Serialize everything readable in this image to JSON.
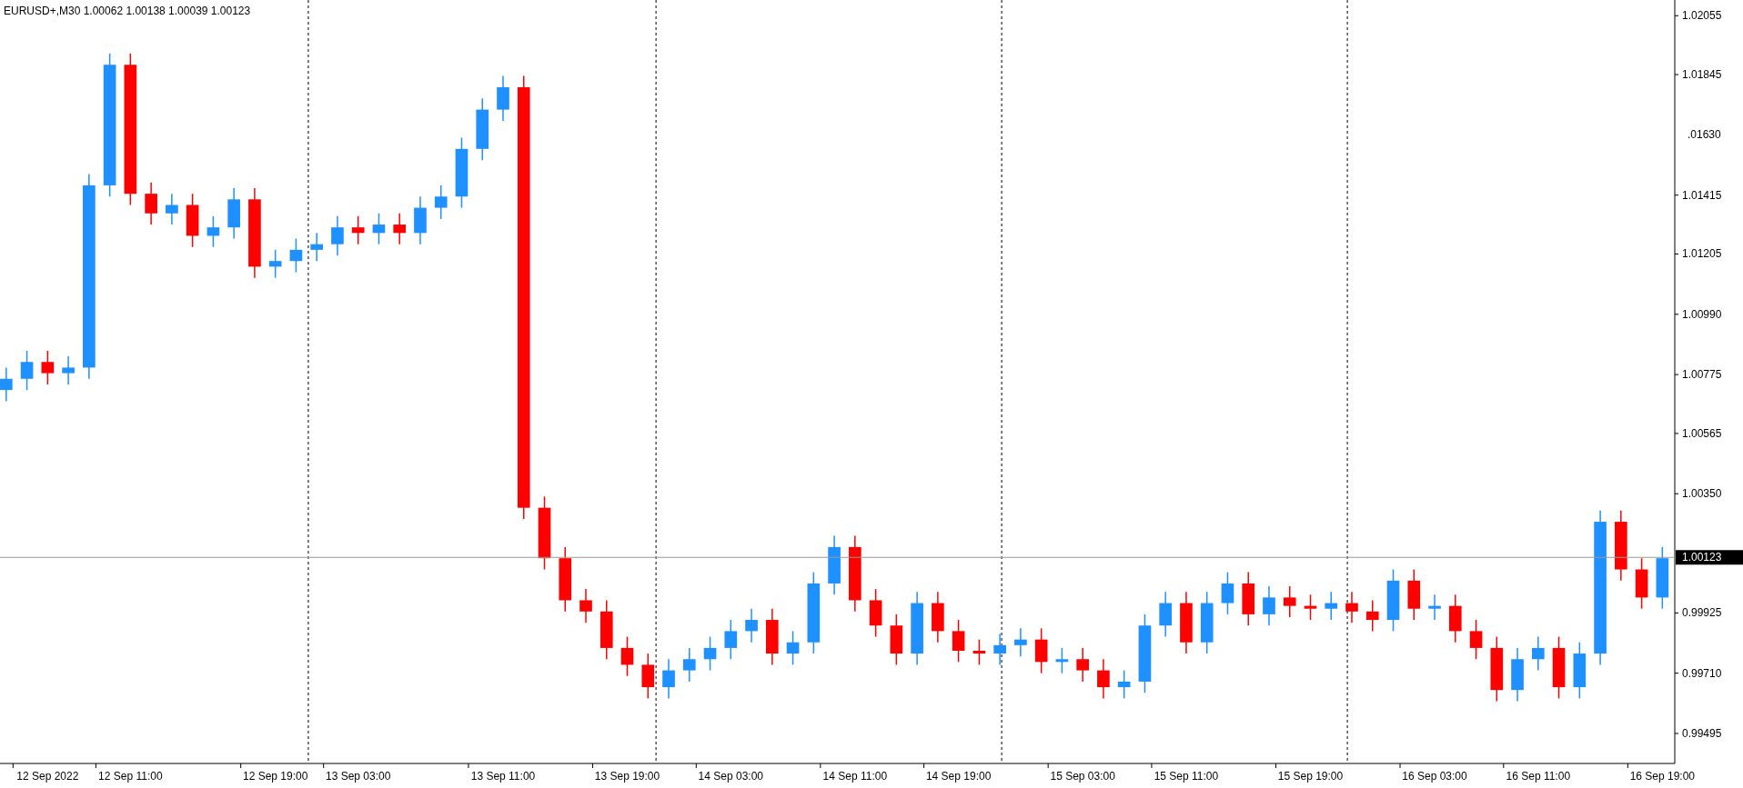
{
  "chart": {
    "title": "EURUSD+,M30  1.00062 1.00138 1.00039 1.00123",
    "clipped_price_label": ".01630",
    "chart_data": {
      "type": "candlestick",
      "ylim": [
        0.99388,
        1.02111
      ],
      "categories": [
        null,
        null,
        "12 Sep 2022",
        null,
        null,
        null,
        "12 Sep 11:00",
        null,
        null,
        null,
        null,
        null,
        null,
        "12 Sep 19:00",
        null,
        null,
        null,
        "13 Sep 03:00",
        null,
        null,
        null,
        null,
        null,
        null,
        "13 Sep 11:00",
        null,
        null,
        null,
        null,
        null,
        "13 Sep 19:00",
        null,
        null,
        null,
        null,
        "14 Sep 03:00",
        null,
        null,
        null,
        null,
        null,
        "14 Sep 11:00",
        null,
        null,
        null,
        null,
        "14 Sep 19:00",
        null,
        null,
        null,
        null,
        null,
        "15 Sep 03:00",
        null,
        null,
        null,
        null,
        "15 Sep 11:00",
        null,
        null,
        null,
        null,
        null,
        "15 Sep 19:00",
        null,
        null,
        null,
        null,
        null,
        "16 Sep 03:00",
        null,
        null,
        null,
        null,
        "16 Sep 11:00",
        null,
        null,
        null,
        null,
        null,
        "16 Sep 19:00"
      ],
      "ohlc": [
        [
          1.0072,
          1.008,
          1.0068,
          1.0076
        ],
        [
          1.0076,
          1.0086,
          1.0072,
          1.0082
        ],
        [
          1.0082,
          1.0086,
          1.0074,
          1.0078
        ],
        [
          1.0078,
          1.0084,
          1.0074,
          1.008
        ],
        [
          1.008,
          1.0149,
          1.0076,
          1.0145
        ],
        [
          1.0145,
          1.0192,
          1.0141,
          1.0188
        ],
        [
          1.0188,
          1.0192,
          1.0138,
          1.0142
        ],
        [
          1.0142,
          1.0146,
          1.0131,
          1.0135
        ],
        [
          1.0135,
          1.0142,
          1.0131,
          1.0138
        ],
        [
          1.0138,
          1.0142,
          1.0123,
          1.0127
        ],
        [
          1.0127,
          1.0134,
          1.0123,
          1.013
        ],
        [
          1.013,
          1.0144,
          1.0126,
          1.014
        ],
        [
          1.014,
          1.0144,
          1.0112,
          1.0116
        ],
        [
          1.0116,
          1.0122,
          1.0112,
          1.0118
        ],
        [
          1.0118,
          1.0126,
          1.0114,
          1.0122
        ],
        [
          1.0122,
          1.0128,
          1.0118,
          1.0124
        ],
        [
          1.0124,
          1.0134,
          1.012,
          1.013
        ],
        [
          1.013,
          1.0134,
          1.0124,
          1.0128
        ],
        [
          1.0128,
          1.0135,
          1.0124,
          1.0131
        ],
        [
          1.0131,
          1.0135,
          1.0124,
          1.0128
        ],
        [
          1.0128,
          1.0141,
          1.0124,
          1.0137
        ],
        [
          1.0137,
          1.0145,
          1.0133,
          1.0141
        ],
        [
          1.0141,
          1.0162,
          1.0137,
          1.0158
        ],
        [
          1.0158,
          1.0176,
          1.0154,
          1.0172
        ],
        [
          1.0172,
          1.0184,
          1.0168,
          1.018
        ],
        [
          1.018,
          1.0184,
          1.0026,
          1.003
        ],
        [
          1.003,
          1.0034,
          1.0008,
          1.0012
        ],
        [
          1.0012,
          1.0016,
          0.9993,
          0.9997
        ],
        [
          0.9997,
          1.0001,
          0.9989,
          0.9993
        ],
        [
          0.9993,
          0.9997,
          0.9976,
          0.998
        ],
        [
          0.998,
          0.9984,
          0.997,
          0.9974
        ],
        [
          0.9974,
          0.9978,
          0.9962,
          0.9966
        ],
        [
          0.9966,
          0.9976,
          0.9962,
          0.9972
        ],
        [
          0.9972,
          0.998,
          0.9968,
          0.9976
        ],
        [
          0.9976,
          0.9984,
          0.9972,
          0.998
        ],
        [
          0.998,
          0.999,
          0.9976,
          0.9986
        ],
        [
          0.9986,
          0.9994,
          0.9982,
          0.999
        ],
        [
          0.999,
          0.9994,
          0.9974,
          0.9978
        ],
        [
          0.9978,
          0.9986,
          0.9974,
          0.9982
        ],
        [
          0.9982,
          1.0007,
          0.9978,
          1.0003
        ],
        [
          1.0003,
          1.002,
          0.9999,
          1.0016
        ],
        [
          1.0016,
          1.002,
          0.9993,
          0.9997
        ],
        [
          0.9997,
          1.0001,
          0.9984,
          0.9988
        ],
        [
          0.9988,
          0.9992,
          0.9974,
          0.9978
        ],
        [
          0.9978,
          1.0,
          0.9974,
          0.9996
        ],
        [
          0.9996,
          1.0,
          0.9982,
          0.9986
        ],
        [
          0.9986,
          0.999,
          0.9975,
          0.9979
        ],
        [
          0.9979,
          0.9983,
          0.9974,
          0.9978
        ],
        [
          0.9978,
          0.9985,
          0.9974,
          0.9981
        ],
        [
          0.9981,
          0.9987,
          0.9977,
          0.9983
        ],
        [
          0.9983,
          0.9987,
          0.9971,
          0.9975
        ],
        [
          0.9975,
          0.998,
          0.9971,
          0.9976
        ],
        [
          0.9976,
          0.998,
          0.9968,
          0.9972
        ],
        [
          0.9972,
          0.9976,
          0.9962,
          0.9966
        ],
        [
          0.9966,
          0.9972,
          0.9962,
          0.9968
        ],
        [
          0.9968,
          0.9992,
          0.9964,
          0.9988
        ],
        [
          0.9988,
          1.0,
          0.9984,
          0.9996
        ],
        [
          0.9996,
          1.0,
          0.9978,
          0.9982
        ],
        [
          0.9982,
          1.0,
          0.9978,
          0.9996
        ],
        [
          0.9996,
          1.0007,
          0.9992,
          1.0003
        ],
        [
          1.0003,
          1.0007,
          0.9988,
          0.9992
        ],
        [
          0.9992,
          1.0002,
          0.9988,
          0.9998
        ],
        [
          0.9998,
          1.0002,
          0.9991,
          0.9995
        ],
        [
          0.9995,
          0.9999,
          0.999,
          0.9994
        ],
        [
          0.9994,
          1.0,
          0.999,
          0.9996
        ],
        [
          0.9996,
          1.0,
          0.9989,
          0.9993
        ],
        [
          0.9993,
          0.9997,
          0.9986,
          0.999
        ],
        [
          0.999,
          1.0008,
          0.9986,
          1.0004
        ],
        [
          1.0004,
          1.0008,
          0.999,
          0.9994
        ],
        [
          0.9994,
          0.9999,
          0.999,
          0.9995
        ],
        [
          0.9995,
          0.9999,
          0.9982,
          0.9986
        ],
        [
          0.9986,
          0.999,
          0.9976,
          0.998
        ],
        [
          0.998,
          0.9984,
          0.9961,
          0.9965
        ],
        [
          0.9965,
          0.998,
          0.9961,
          0.9976
        ],
        [
          0.9976,
          0.9984,
          0.9972,
          0.998
        ],
        [
          0.998,
          0.9984,
          0.9962,
          0.9966
        ],
        [
          0.9966,
          0.9982,
          0.9962,
          0.9978
        ],
        [
          0.9978,
          1.0029,
          0.9974,
          1.0025
        ],
        [
          1.0025,
          1.0029,
          1.0004,
          1.0008
        ],
        [
          1.0008,
          1.0012,
          0.9994,
          0.9998
        ],
        [
          0.9998,
          1.0016,
          0.9994,
          1.0012
        ]
      ],
      "yticks": [
        {
          "value": 1.02055,
          "label": "1.02055"
        },
        {
          "value": 1.01845,
          "label": "1.01845"
        },
        {
          "value": 1.01415,
          "label": "1.01415"
        },
        {
          "value": 1.01205,
          "label": "1.01205"
        },
        {
          "value": 1.0099,
          "label": "1.00990"
        },
        {
          "value": 1.00775,
          "label": "1.00775"
        },
        {
          "value": 1.00565,
          "label": "1.00565"
        },
        {
          "value": 1.0035,
          "label": "1.00350"
        },
        {
          "value": 0.99925,
          "label": "0.99925"
        },
        {
          "value": 0.9971,
          "label": "0.99710"
        },
        {
          "value": 0.99495,
          "label": "0.99495"
        }
      ],
      "ref_lines": [
        {
          "axis": "y",
          "value": 1.00123,
          "label": "1.00123"
        }
      ]
    }
  }
}
